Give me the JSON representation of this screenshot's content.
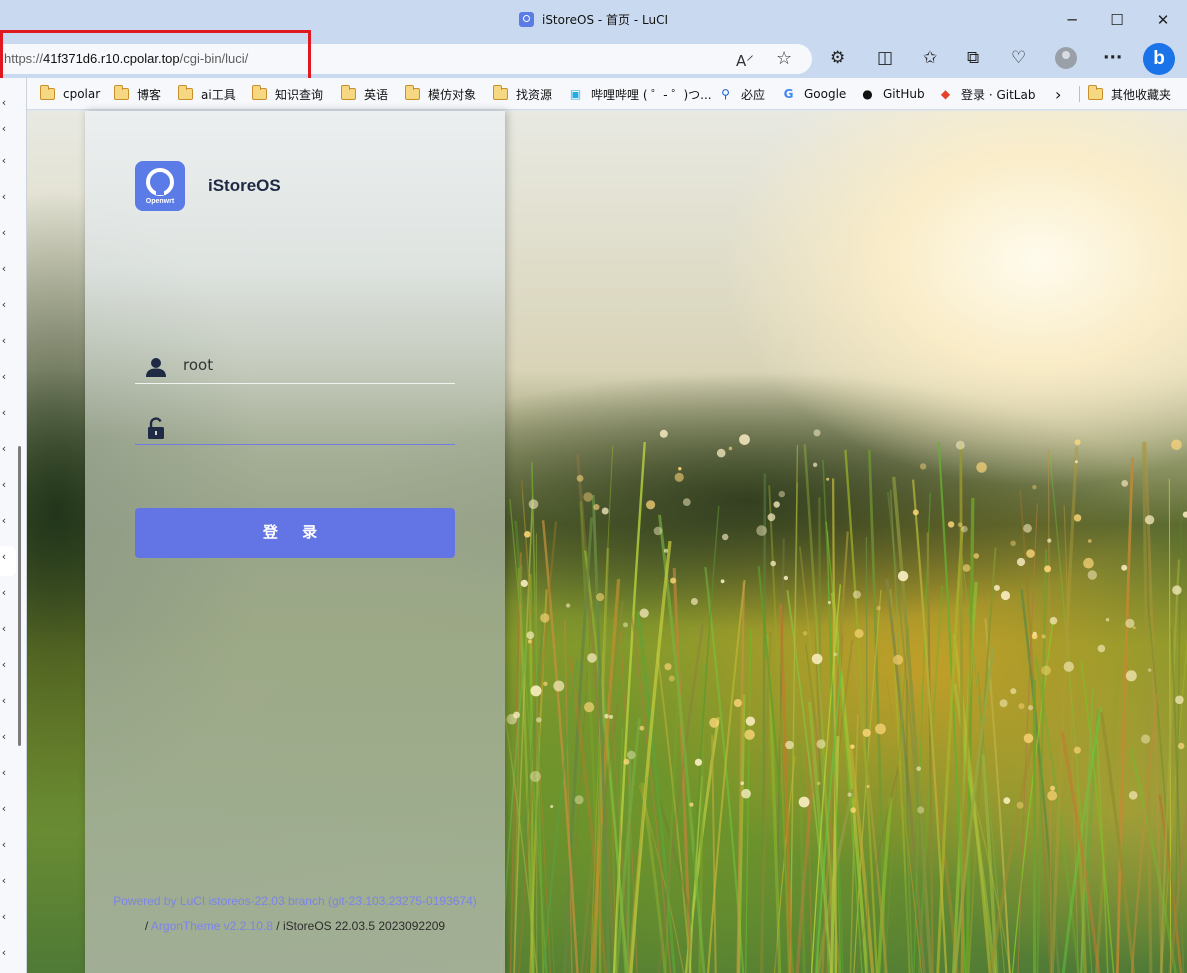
{
  "window": {
    "title": "iStoreOS - 首页 - LuCI",
    "minimize_glyph": "─",
    "maximize_glyph": "☐",
    "close_glyph": "✕"
  },
  "address_bar": {
    "url_scheme": "https://",
    "url_host": "41f371d6.r10.cpolar.top",
    "url_path": "/cgi-bin/luci/",
    "read_aloud_glyph": "A⸍",
    "favorite_glyph": "☆"
  },
  "toolbar_icons": {
    "extensions": "⚙",
    "split_screen": "◫",
    "favorites": "✩",
    "collections": "⧉",
    "health": "♡",
    "more": "···",
    "bing": "b"
  },
  "bookmarks": [
    {
      "label": "cpolar",
      "icon": "folder-icon"
    },
    {
      "label": "博客",
      "icon": "folder-icon"
    },
    {
      "label": "ai工具",
      "icon": "folder-icon"
    },
    {
      "label": "知识查询",
      "icon": "folder-icon"
    },
    {
      "label": "英语",
      "icon": "folder-icon"
    },
    {
      "label": "模仿对象",
      "icon": "folder-icon"
    },
    {
      "label": "找资源",
      "icon": "folder-icon"
    },
    {
      "label": "哔哩哔哩 ( ゜- ゜)つ...",
      "icon": "bilibili-icon"
    },
    {
      "label": "必应",
      "icon": "search-icon"
    },
    {
      "label": "Google",
      "icon": "google-icon"
    },
    {
      "label": "GitHub",
      "icon": "github-icon"
    },
    {
      "label": "登录 · GitLab",
      "icon": "gitlab-icon"
    }
  ],
  "bookmarks_more_glyph": "›",
  "other_bookmarks": "其他收藏夹",
  "login": {
    "brand": "iStoreOS",
    "logo_text": "Openwrt",
    "username_value": "root",
    "password_value": "",
    "button_label": "登 录"
  },
  "footer": {
    "line1": "Powered by LuCI istoreos-22.03 branch (git-23.103.23275-0193674)",
    "line2_prefix": "/ ",
    "theme_link": "ArgonTheme v2.2.10.8",
    "line2_suffix": " / iStoreOS 22.03.5 2023092209"
  },
  "colors": {
    "accent": "#6374e5",
    "link": "#7b84ea",
    "highlight": "#e0181f"
  }
}
